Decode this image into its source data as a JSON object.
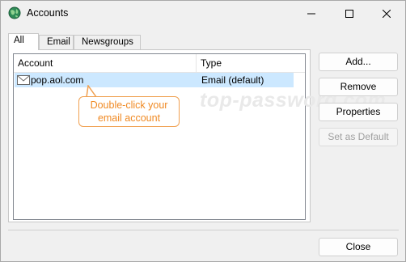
{
  "window": {
    "title": "Accounts"
  },
  "tabs": [
    {
      "label": "All",
      "active": true
    },
    {
      "label": "Email",
      "active": false
    },
    {
      "label": "Newsgroups",
      "active": false
    }
  ],
  "list": {
    "columns": [
      "Account",
      "Type"
    ],
    "rows": [
      {
        "account": "pop.aol.com",
        "type": "Email (default)",
        "selected": true
      }
    ]
  },
  "callout": {
    "line1": "Double-click your",
    "line2": "email account"
  },
  "watermark": "top-password.com",
  "buttons": {
    "add": "Add...",
    "remove": "Remove",
    "properties": "Properties",
    "set_default": "Set as Default",
    "close": "Close"
  },
  "colors": {
    "selection": "#cce8ff",
    "callout": "#f0a050",
    "callout_text": "#f08a24"
  },
  "icons": {
    "app": "globe-icon",
    "account": "envelope-icon"
  }
}
